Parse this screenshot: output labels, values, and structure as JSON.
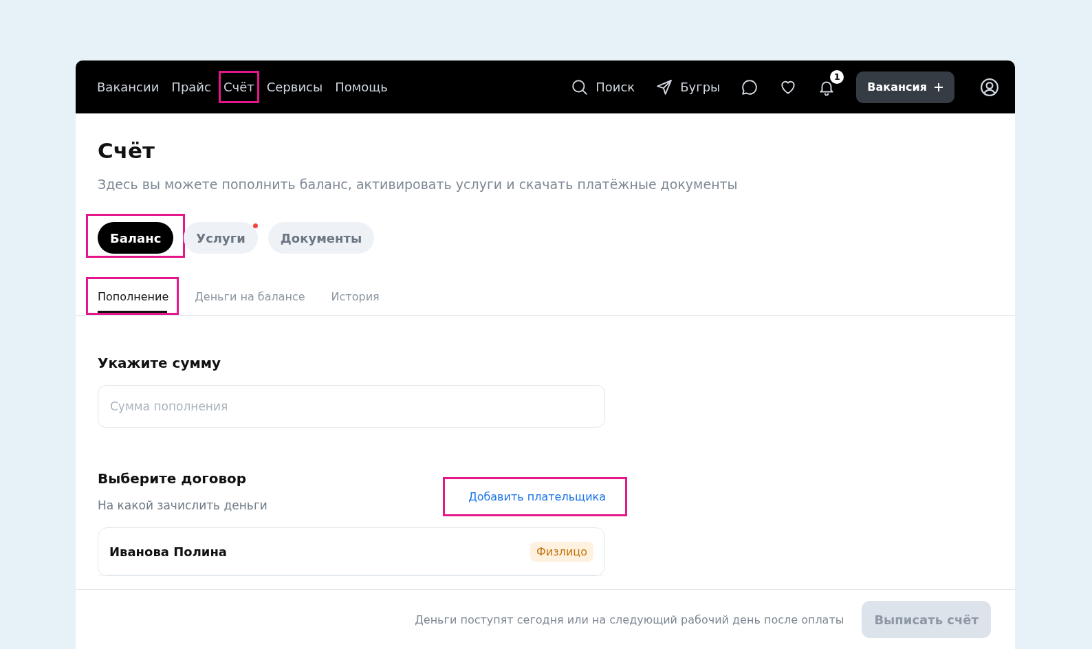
{
  "nav": {
    "items": [
      {
        "label": "Вакансии",
        "highlighted": false
      },
      {
        "label": "Прайс",
        "highlighted": false
      },
      {
        "label": "Счёт",
        "highlighted": true
      },
      {
        "label": "Сервисы",
        "highlighted": false
      },
      {
        "label": "Помощь",
        "highlighted": false
      }
    ],
    "search": "Поиск",
    "location": "Бугры",
    "notifications_count": "1",
    "create_button": "Вакансия"
  },
  "page": {
    "title": "Счёт",
    "subtitle": "Здесь вы можете пополнить баланс, активировать услуги и скачать платёжные документы"
  },
  "tabs": [
    {
      "label": "Баланс",
      "selected": true,
      "highlighted": true,
      "notification": false
    },
    {
      "label": "Услуги",
      "selected": false,
      "highlighted": false,
      "notification": true
    },
    {
      "label": "Документы",
      "selected": false,
      "highlighted": false,
      "notification": false
    }
  ],
  "subtabs": [
    {
      "label": "Пополнение",
      "selected": true,
      "highlighted": true
    },
    {
      "label": "Деньги на балансе",
      "selected": false,
      "highlighted": false
    },
    {
      "label": "История",
      "selected": false,
      "highlighted": false
    }
  ],
  "amount": {
    "heading": "Укажите сумму",
    "placeholder": "Сумма пополнения"
  },
  "contract": {
    "heading": "Выберите договор",
    "hint": "На какой зачислить деньги",
    "add_link": {
      "label": "Добавить плательщика",
      "highlighted": true
    },
    "items": [
      {
        "name": "Иванова Полина",
        "tag": "Физлицо"
      }
    ]
  },
  "footer": {
    "note": "Деньги поступят сегодня или на следующий рабочий день после оплаты",
    "button": {
      "label": "Выписать счёт",
      "disabled": true
    }
  }
}
